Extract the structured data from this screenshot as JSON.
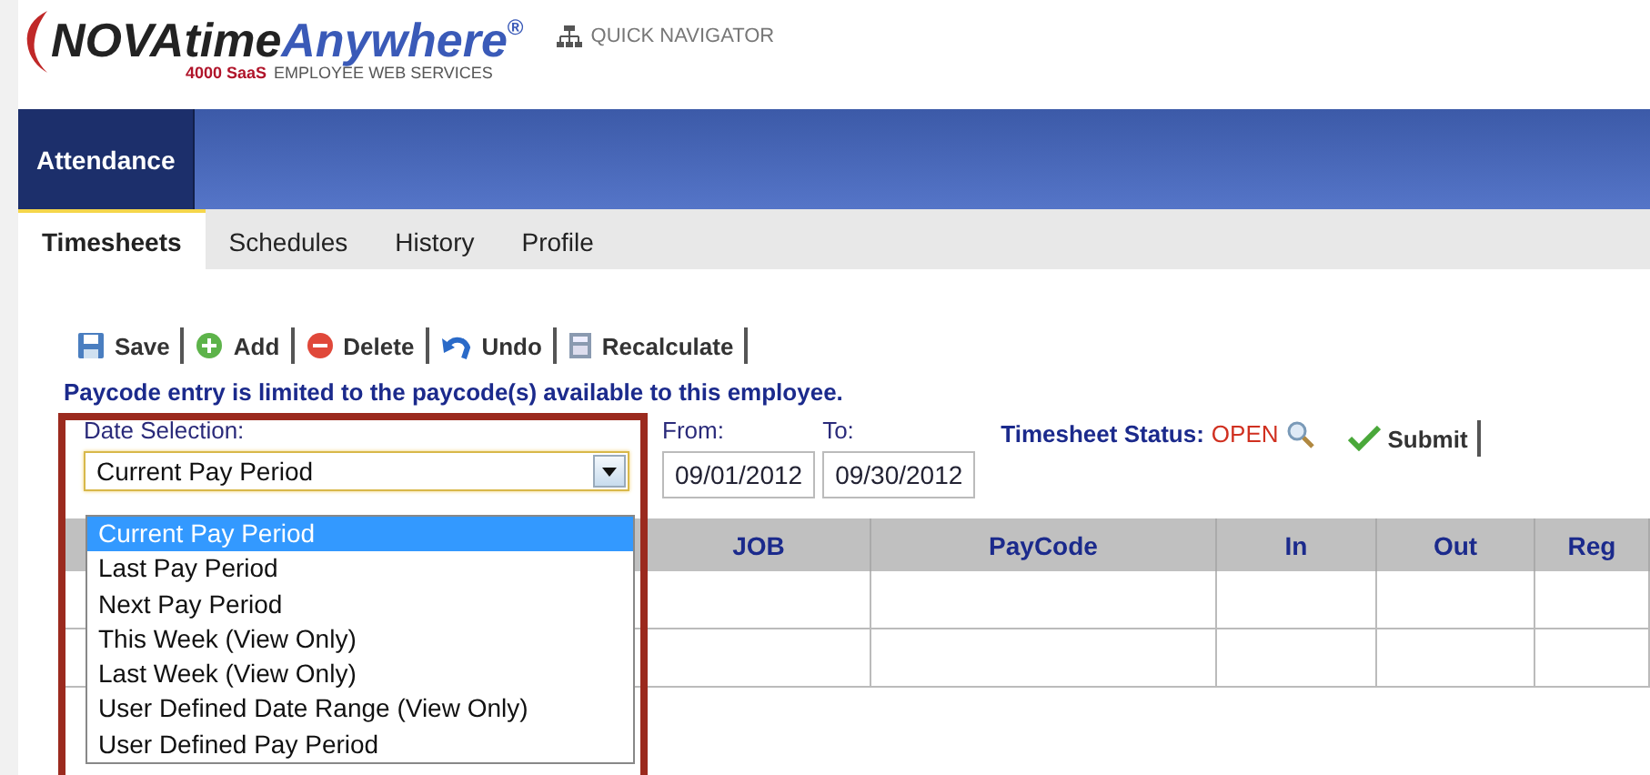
{
  "logo": {
    "brand_dark": "NOVAtime",
    "brand_blue": "Anywhere",
    "registered": "®",
    "product": "4000 SaaS",
    "tagline": "EMPLOYEE WEB SERVICES"
  },
  "quick_navigator": "QUICK NAVIGATOR",
  "main_nav": [
    {
      "label": "Attendance",
      "selected": true
    }
  ],
  "tabs": [
    {
      "label": "Timesheets",
      "selected": true
    },
    {
      "label": "Schedules",
      "selected": false
    },
    {
      "label": "History",
      "selected": false
    },
    {
      "label": "Profile",
      "selected": false
    }
  ],
  "toolbar": [
    {
      "kind": "save",
      "label": "Save"
    },
    {
      "kind": "add",
      "label": "Add"
    },
    {
      "kind": "delete",
      "label": "Delete"
    },
    {
      "kind": "undo",
      "label": "Undo"
    },
    {
      "kind": "recalculate",
      "label": "Recalculate"
    }
  ],
  "notice": "Paycode entry is limited to the paycode(s) available to this employee.",
  "date_selection": {
    "label": "Date Selection:",
    "value": "Current Pay Period",
    "expanded": true,
    "options": [
      {
        "label": "Current Pay Period",
        "selected": true
      },
      {
        "label": "Last Pay Period",
        "selected": false
      },
      {
        "label": "Next Pay Period",
        "selected": false
      },
      {
        "label": "This Week (View Only)",
        "selected": false
      },
      {
        "label": "Last Week (View Only)",
        "selected": false
      },
      {
        "label": "User Defined Date Range (View Only)",
        "selected": false
      },
      {
        "label": "User Defined Pay Period",
        "selected": false
      }
    ]
  },
  "from": {
    "label": "From:",
    "value": "09/01/2012"
  },
  "to": {
    "label": "To:",
    "value": "09/30/2012"
  },
  "status": {
    "label": "Timesheet Status:",
    "value": "OPEN"
  },
  "submit": "Submit",
  "table": {
    "columns": [
      "JOB",
      "PayCode",
      "In",
      "Out",
      "Reg"
    ]
  }
}
